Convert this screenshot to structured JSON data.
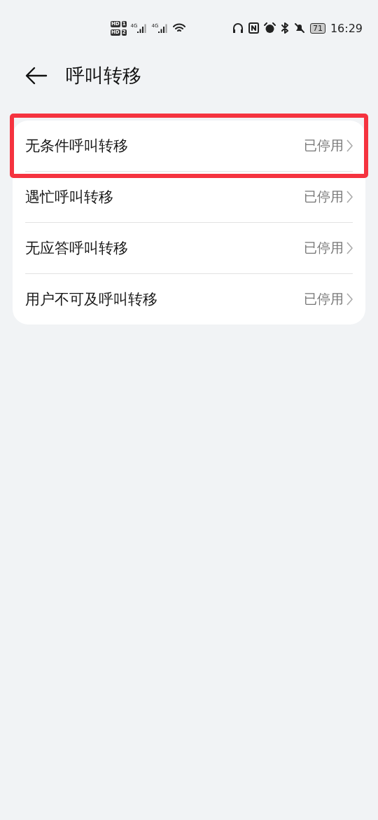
{
  "status_bar": {
    "hd_badges": [
      {
        "label": "HD",
        "slot": "1"
      },
      {
        "label": "HD",
        "slot": "2"
      }
    ],
    "networks": [
      "4G",
      "4G"
    ],
    "battery": "71",
    "time": "16:29"
  },
  "header": {
    "title": "呼叫转移"
  },
  "items": [
    {
      "label": "无条件呼叫转移",
      "value": "已停用",
      "highlighted": true
    },
    {
      "label": "遇忙呼叫转移",
      "value": "已停用",
      "highlighted": false
    },
    {
      "label": "无应答呼叫转移",
      "value": "已停用",
      "highlighted": false
    },
    {
      "label": "用户不可及呼叫转移",
      "value": "已停用",
      "highlighted": false
    }
  ]
}
